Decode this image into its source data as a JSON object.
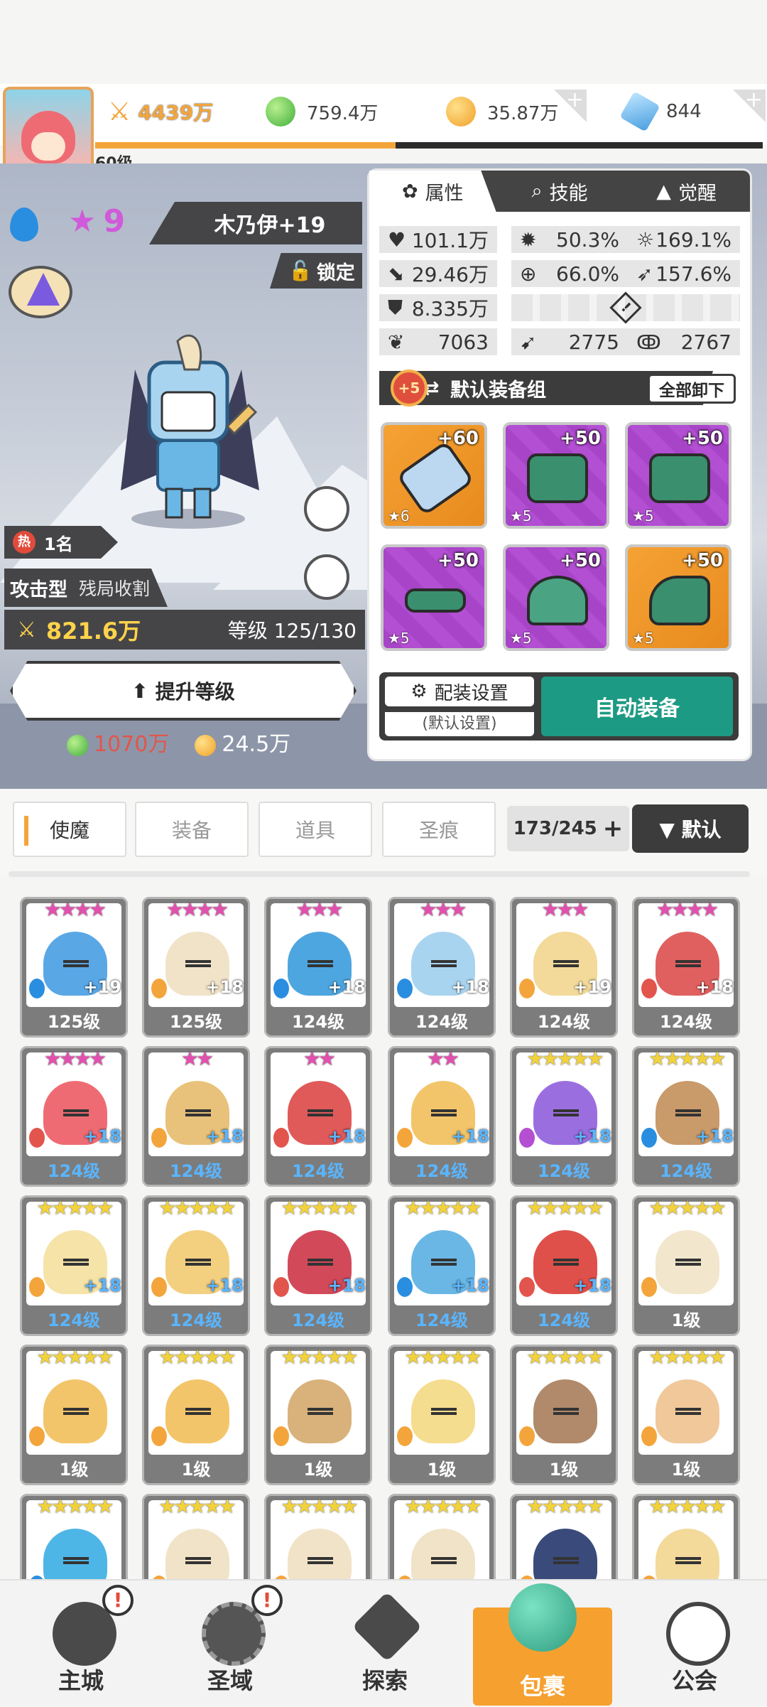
{
  "topbar": {
    "player_level": "60级",
    "power": "4439万",
    "green_currency": "759.4万",
    "gold_currency": "35.87万",
    "diamond_currency": "844",
    "xp_progress": 0.45,
    "plus_symbol": "+"
  },
  "hero": {
    "element": "water-drop-icon",
    "star_count": "9",
    "name": "木乃伊+19",
    "lock_label": "锁定",
    "hot_icon_label": "热",
    "rank_label": "1名",
    "type_label": "攻击型",
    "trait_label": "残局收割",
    "power": "821.6万",
    "level_label": "等级 125/130",
    "upgrade_label": "提升等级",
    "cost_green": "1070万",
    "cost_gold": "24.5万"
  },
  "panel": {
    "tabs": [
      {
        "label": "属性",
        "icon": "attribute-icon"
      },
      {
        "label": "技能",
        "icon": "skill-icon"
      },
      {
        "label": "觉醒",
        "icon": "awaken-icon"
      }
    ],
    "stats": {
      "hp": "101.1万",
      "crit_rate": "50.3%",
      "crit_dmg": "169.1%",
      "atk": "29.46万",
      "accuracy": "66.0%",
      "speed_rate": "157.6%",
      "def": "8.335万",
      "warning_symbol": "!",
      "s1": "7063",
      "s2": "2775",
      "s3": "2767"
    },
    "set_badge": "+5",
    "set_name": "默认装备组",
    "unload_all": "全部卸下",
    "equipment": [
      {
        "level": "+60",
        "stars": "★6",
        "color": "orange"
      },
      {
        "level": "+50",
        "stars": "★5",
        "color": "purple"
      },
      {
        "level": "+50",
        "stars": "★5",
        "color": "purple"
      },
      {
        "level": "+50",
        "stars": "★5",
        "color": "purple"
      },
      {
        "level": "+50",
        "stars": "★5",
        "color": "purple"
      },
      {
        "level": "+50",
        "stars": "★5",
        "color": "orange"
      }
    ],
    "config_label": "配装设置",
    "config_sub": "(默认设置)",
    "auto_equip": "自动装备"
  },
  "inventory": {
    "tabs": [
      "使魔",
      "装备",
      "道具",
      "圣痕"
    ],
    "count": "173/245",
    "count_plus": "+",
    "sort_label": "▼ 默认",
    "cards": [
      {
        "stars": "★★★★",
        "star_color": "#e34fae",
        "plus": "+19",
        "level": "125级",
        "blob": "#5aa7e6",
        "elem": "#2a8ee0"
      },
      {
        "stars": "★★★★",
        "star_color": "#e34fae",
        "plus": "+18",
        "level": "125级",
        "blob": "#f1e3c8",
        "elem": "#f3a53c"
      },
      {
        "stars": "★★★",
        "star_color": "#e34fae",
        "plus": "+18",
        "level": "124级",
        "blob": "#4ea6e0",
        "elem": "#2a8ee0"
      },
      {
        "stars": "★★★",
        "star_color": "#e34fae",
        "plus": "+18",
        "level": "124级",
        "blob": "#a9d4f0",
        "elem": "#2a8ee0"
      },
      {
        "stars": "★★★",
        "star_color": "#e34fae",
        "plus": "+19",
        "level": "124级",
        "blob": "#f3d99a",
        "elem": "#f3a53c"
      },
      {
        "stars": "★★★★",
        "star_color": "#e34fae",
        "plus": "+18",
        "level": "124级",
        "blob": "#e06060",
        "elem": "#e2554d"
      },
      {
        "stars": "★★★★",
        "star_color": "#e34fae",
        "plus": "+18",
        "level": "124级",
        "blob": "#ef6b73",
        "elem": "#e2554d",
        "blue": true
      },
      {
        "stars": "★★",
        "star_color": "#e34fae",
        "plus": "+18",
        "level": "124级",
        "blob": "#e8c27a",
        "elem": "#f3a53c",
        "blue": true
      },
      {
        "stars": "★★",
        "star_color": "#e34fae",
        "plus": "+18",
        "level": "124级",
        "blob": "#e05a5a",
        "elem": "#e2554d",
        "blue": true
      },
      {
        "stars": "★★",
        "star_color": "#e34fae",
        "plus": "+18",
        "level": "124级",
        "blob": "#f3c56a",
        "elem": "#f3a53c",
        "blue": true
      },
      {
        "stars": "★★★★★",
        "star_color": "#f2d23a",
        "plus": "+18",
        "level": "124级",
        "blob": "#9b6ee0",
        "elem": "#b44fd2",
        "blue": true
      },
      {
        "stars": "★★★★★",
        "star_color": "#f2d23a",
        "plus": "+18",
        "level": "124级",
        "blob": "#c99a6a",
        "elem": "#2a8ee0",
        "blue": true
      },
      {
        "stars": "★★★★★",
        "star_color": "#f2d23a",
        "plus": "+18",
        "level": "124级",
        "blob": "#f6e3a8",
        "elem": "#f3a53c",
        "blue": true
      },
      {
        "stars": "★★★★★",
        "star_color": "#f2d23a",
        "plus": "+18",
        "level": "124级",
        "blob": "#f3d080",
        "elem": "#f3a53c",
        "blue": true
      },
      {
        "stars": "★★★★★",
        "star_color": "#f2d23a",
        "plus": "+18",
        "level": "124级",
        "blob": "#d24a5a",
        "elem": "#e2554d",
        "blue": true
      },
      {
        "stars": "★★★★★",
        "star_color": "#f2d23a",
        "plus": "+18",
        "level": "124级",
        "blob": "#6ab7e6",
        "elem": "#2a8ee0",
        "blue": true
      },
      {
        "stars": "★★★★★",
        "star_color": "#f2d23a",
        "plus": "+18",
        "level": "124级",
        "blob": "#e0504a",
        "elem": "#e2554d",
        "blue": true
      },
      {
        "stars": "★★★★★",
        "star_color": "#f2d23a",
        "plus": "",
        "level": "1级",
        "blob": "#f2e6cc",
        "elem": "#f3a53c"
      },
      {
        "stars": "★★★★★",
        "star_color": "#f2d23a",
        "plus": "",
        "level": "1级",
        "blob": "#f3c56a",
        "elem": "#f3a53c"
      },
      {
        "stars": "★★★★★",
        "star_color": "#f2d23a",
        "plus": "",
        "level": "1级",
        "blob": "#f3c56a",
        "elem": "#f3a53c"
      },
      {
        "stars": "★★★★★",
        "star_color": "#f2d23a",
        "plus": "",
        "level": "1级",
        "blob": "#d8b27a",
        "elem": "#f3a53c"
      },
      {
        "stars": "★★★★★",
        "star_color": "#f2d23a",
        "plus": "",
        "level": "1级",
        "blob": "#f5dd90",
        "elem": "#f3a53c"
      },
      {
        "stars": "★★★★★",
        "star_color": "#f2d23a",
        "plus": "",
        "level": "1级",
        "blob": "#b08a6a",
        "elem": "#f3a53c"
      },
      {
        "stars": "★★★★★",
        "star_color": "#f2d23a",
        "plus": "",
        "level": "1级",
        "blob": "#f0c89a",
        "elem": "#f3a53c"
      },
      {
        "stars": "★★★★★",
        "star_color": "#f2d23a",
        "plus": "",
        "level": "",
        "blob": "#4eb6e6",
        "elem": "#2a8ee0"
      },
      {
        "stars": "★★★★★",
        "star_color": "#f2d23a",
        "plus": "",
        "level": "",
        "blob": "#f1e3c8",
        "elem": "#f3a53c"
      },
      {
        "stars": "★★★★★",
        "star_color": "#f2d23a",
        "plus": "",
        "level": "",
        "blob": "#f1e3c8",
        "elem": "#f3a53c"
      },
      {
        "stars": "★★★★★",
        "star_color": "#f2d23a",
        "plus": "",
        "level": "",
        "blob": "#f1e3c8",
        "elem": "#f3a53c"
      },
      {
        "stars": "★★★★★",
        "star_color": "#f2d23a",
        "plus": "",
        "level": "",
        "blob": "#3a4a7a",
        "elem": "#f3a53c"
      },
      {
        "stars": "★★★★★",
        "star_color": "#f2d23a",
        "plus": "",
        "level": "",
        "blob": "#f3d99a",
        "elem": "#f3a53c"
      }
    ]
  },
  "nav": {
    "items": [
      {
        "label": "主城",
        "badge": "!"
      },
      {
        "label": "圣域",
        "badge": "!"
      },
      {
        "label": "探索",
        "badge": ""
      },
      {
        "label": "包裹",
        "badge": ""
      },
      {
        "label": "公会",
        "badge": ""
      }
    ]
  },
  "colors": {
    "accent_orange": "#f5a02f",
    "teal_button": "#1d9a83",
    "dark_panel": "#3c3c3c"
  }
}
